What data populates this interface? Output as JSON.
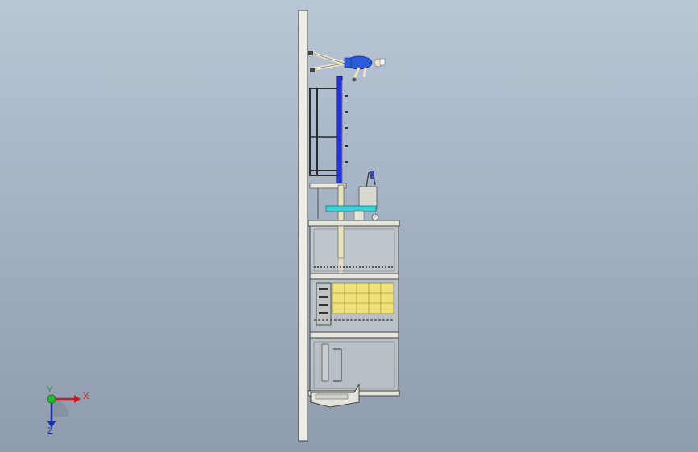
{
  "viewport": {
    "background_top": "#b9c6d6",
    "background_bottom": "#8e9cad"
  },
  "model": {
    "frame_color": "#e8e6da",
    "edge_color": "#3c3c3c",
    "panel_blue": "#2433d8",
    "rail_cyan": "#3fd0d8",
    "tray_yellow": "#f0e27a",
    "operator_shirt": "#2c5ad8"
  },
  "triad": {
    "x_label": "X",
    "y_label": "Y",
    "z_label": "Z",
    "x_color": "#d01818",
    "y_color": "#1f9a1f",
    "z_color": "#1d2db0"
  }
}
